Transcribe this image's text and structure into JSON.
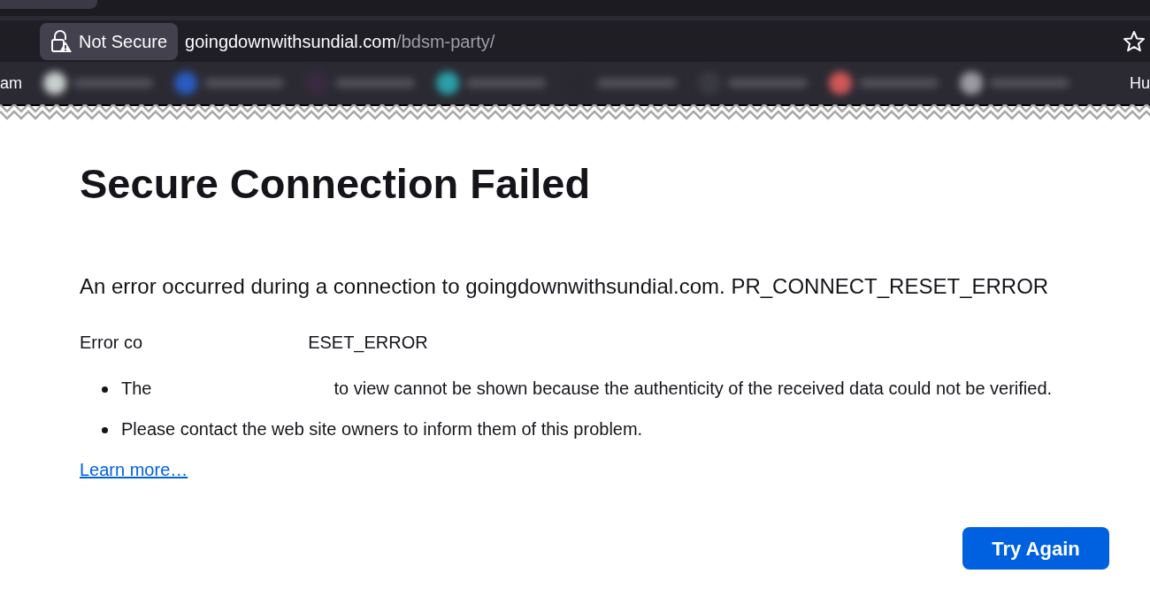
{
  "browser": {
    "security_label": "Not Secure",
    "url_host": "goingdownwithsundial.com",
    "url_path": "/bdsm-party/",
    "bookmarks_left_fragment": "am",
    "bookmarks_right_fragment": "Hu",
    "bookmarks": [
      {
        "color": "#c8d0cc"
      },
      {
        "color": "#2a5cc0"
      },
      {
        "color": "#3a2a40"
      },
      {
        "color": "#2aa0a8"
      },
      {
        "color": "#2a2830"
      },
      {
        "color": "#3a3a44"
      },
      {
        "color": "#d05858"
      },
      {
        "color": "#9a9aa0"
      }
    ]
  },
  "page": {
    "title": "Secure Connection Failed",
    "message": "An error occurred during a connection to goingdownwithsundial.com. PR_CONNECT_RESET_ERROR",
    "error_code_parts": [
      "Error co",
      "ESET_ERROR"
    ],
    "bullets": [
      {
        "parts": [
          "The",
          "to view cannot be shown because the authenticity of the received data could not be verified."
        ]
      },
      {
        "parts": [
          "Please contact the web site owners to inform them of this problem."
        ]
      }
    ],
    "learn_more": "Learn more…",
    "button": "Try Again"
  }
}
